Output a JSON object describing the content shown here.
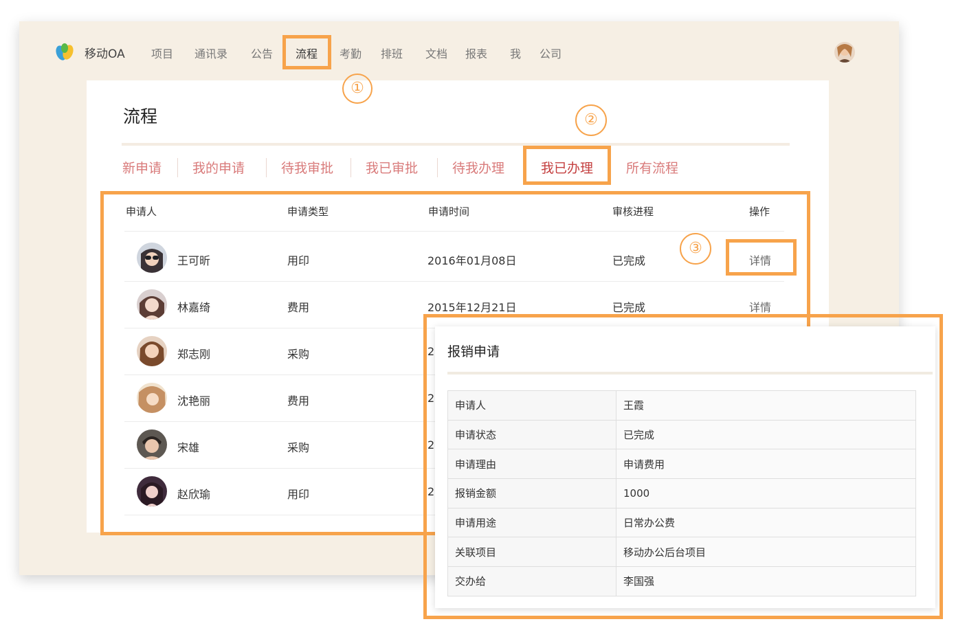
{
  "app": {
    "name": "移动OA"
  },
  "nav": {
    "items": [
      {
        "label": "项目"
      },
      {
        "label": "通讯录"
      },
      {
        "label": "公告"
      },
      {
        "label": "流程"
      },
      {
        "label": "考勤"
      },
      {
        "label": "排班"
      },
      {
        "label": "文档"
      },
      {
        "label": "报表"
      },
      {
        "label": "我"
      },
      {
        "label": "公司"
      }
    ],
    "active": "流程"
  },
  "page": {
    "title": "流程"
  },
  "tabs": {
    "items": [
      {
        "label": "新申请"
      },
      {
        "label": "我的申请"
      },
      {
        "label": "待我审批"
      },
      {
        "label": "我已审批"
      },
      {
        "label": "待我办理"
      },
      {
        "label": "我已办理"
      },
      {
        "label": "所有流程"
      }
    ],
    "active": "我已办理"
  },
  "table": {
    "headers": [
      "申请人",
      "申请类型",
      "申请时间",
      "审核进程",
      "操作"
    ],
    "rows": [
      {
        "name": "王可昕",
        "type": "用印",
        "time": "2016年01月08日",
        "status": "已完成",
        "action": "详情"
      },
      {
        "name": "林嘉绮",
        "type": "费用",
        "time": "2015年12月21日",
        "status": "已完成",
        "action": "详情"
      },
      {
        "name": "郑志刚",
        "type": "采购",
        "time": "20"
      },
      {
        "name": "沈艳丽",
        "type": "费用",
        "time": "20"
      },
      {
        "name": "宋雄",
        "type": "采购",
        "time": "20"
      },
      {
        "name": "赵欣瑜",
        "type": "用印",
        "time": "20"
      }
    ]
  },
  "annotations": [
    "①",
    "②",
    "③"
  ],
  "popup": {
    "title": "报销申请",
    "fields": [
      {
        "key": "申请人",
        "value": "王霞"
      },
      {
        "key": "申请状态",
        "value": "已完成"
      },
      {
        "key": "申请理由",
        "value": "申请费用"
      },
      {
        "key": "报销金额",
        "value": "1000"
      },
      {
        "key": "申请用途",
        "value": "日常办公费"
      },
      {
        "key": "关联项目",
        "value": "移动办公后台项目"
      },
      {
        "key": "交办给",
        "value": "李国强"
      }
    ]
  },
  "colors": {
    "highlight": "#f7a34b",
    "background": "#f6efe4",
    "tab_text": "#d97b7b",
    "tab_active": "#c43f3f"
  }
}
